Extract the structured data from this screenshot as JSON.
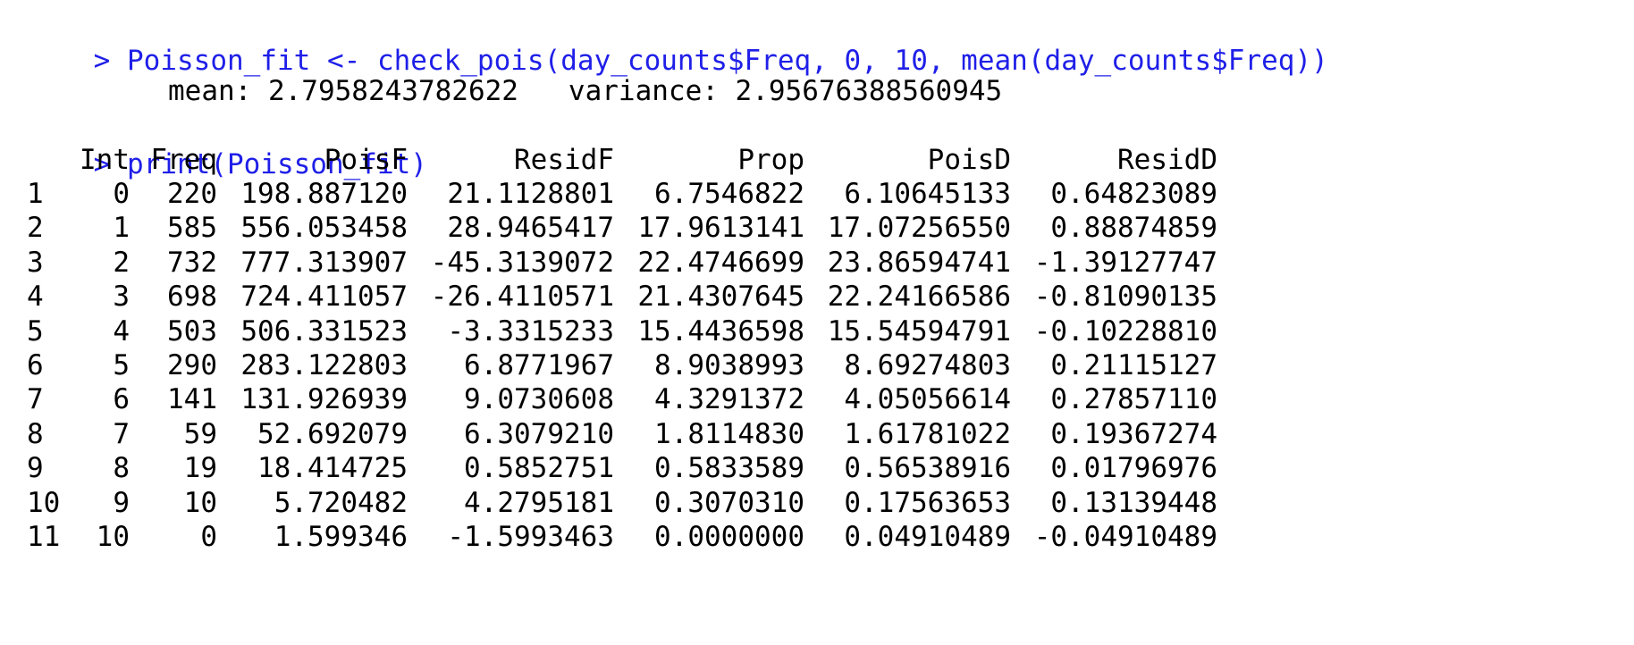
{
  "colors": {
    "command": "#1f1fe8",
    "output": "#000000",
    "background": "#ffffff"
  },
  "console": {
    "prompt_symbol": ">",
    "command1": "Poisson_fit <- check_pois(day_counts$Freq, 0, 10, mean(day_counts$Freq))",
    "stats_line": "mean: 2.7958243782622   variance: 2.95676388560945",
    "command2": "print(Poisson_fit)"
  },
  "table": {
    "columns": [
      "Int",
      "Freq",
      "PoisF",
      "ResidF",
      "Prop",
      "PoisD",
      "ResidD"
    ],
    "rows": [
      {
        "rn": "1",
        "cells": [
          "0",
          "220",
          "198.887120",
          "21.1128801",
          "6.7546822",
          "6.10645133",
          "0.64823089"
        ]
      },
      {
        "rn": "2",
        "cells": [
          "1",
          "585",
          "556.053458",
          "28.9465417",
          "17.9613141",
          "17.07256550",
          "0.88874859"
        ]
      },
      {
        "rn": "3",
        "cells": [
          "2",
          "732",
          "777.313907",
          "-45.3139072",
          "22.4746699",
          "23.86594741",
          "-1.39127747"
        ]
      },
      {
        "rn": "4",
        "cells": [
          "3",
          "698",
          "724.411057",
          "-26.4110571",
          "21.4307645",
          "22.24166586",
          "-0.81090135"
        ]
      },
      {
        "rn": "5",
        "cells": [
          "4",
          "503",
          "506.331523",
          "-3.3315233",
          "15.4436598",
          "15.54594791",
          "-0.10228810"
        ]
      },
      {
        "rn": "6",
        "cells": [
          "5",
          "290",
          "283.122803",
          "6.8771967",
          "8.9038993",
          "8.69274803",
          "0.21115127"
        ]
      },
      {
        "rn": "7",
        "cells": [
          "6",
          "141",
          "131.926939",
          "9.0730608",
          "4.3291372",
          "4.05056614",
          "0.27857110"
        ]
      },
      {
        "rn": "8",
        "cells": [
          "7",
          "59",
          "52.692079",
          "6.3079210",
          "1.8114830",
          "1.61781022",
          "0.19367274"
        ]
      },
      {
        "rn": "9",
        "cells": [
          "8",
          "19",
          "18.414725",
          "0.5852751",
          "0.5833589",
          "0.56538916",
          "0.01796976"
        ]
      },
      {
        "rn": "10",
        "cells": [
          "9",
          "10",
          "5.720482",
          "4.2795181",
          "0.3070310",
          "0.17563653",
          "0.13139448"
        ]
      },
      {
        "rn": "11",
        "cells": [
          "10",
          "0",
          "1.599346",
          "-1.5993463",
          "0.0000000",
          "0.04910489",
          "-0.04910489"
        ]
      }
    ]
  }
}
